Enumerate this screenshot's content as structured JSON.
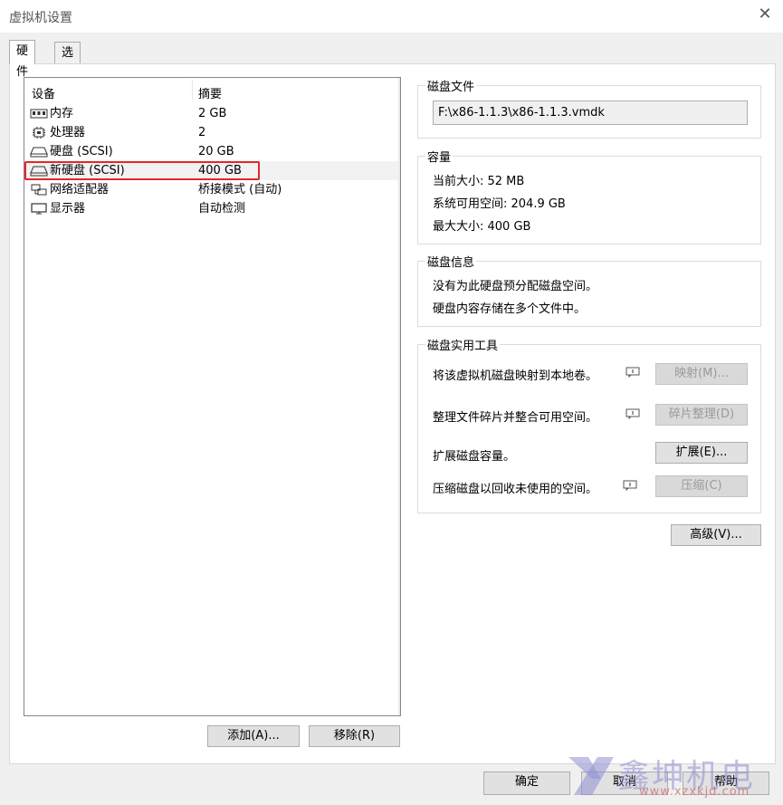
{
  "window": {
    "title": "虚拟机设置",
    "close_glyph": "✕"
  },
  "tabs": [
    {
      "label": "硬件",
      "active": true
    },
    {
      "label": "选项",
      "active": false
    }
  ],
  "devices": {
    "col_device": "设备",
    "col_summary": "摘要",
    "rows": [
      {
        "icon": "memory-icon",
        "name": "内存",
        "summary": "2 GB"
      },
      {
        "icon": "processor-icon",
        "name": "处理器",
        "summary": "2"
      },
      {
        "icon": "disk-icon",
        "name": "硬盘 (SCSI)",
        "summary": "20 GB"
      },
      {
        "icon": "disk-icon",
        "name": "新硬盘 (SCSI)",
        "summary": "400 GB",
        "selected": true
      },
      {
        "icon": "network-adapter-icon",
        "name": "网络适配器",
        "summary": "桥接模式 (自动)"
      },
      {
        "icon": "display-icon",
        "name": "显示器",
        "summary": "自动检测"
      }
    ],
    "add_button": "添加(A)...",
    "remove_button": "移除(R)"
  },
  "disk_file": {
    "label": "磁盘文件",
    "path": "F:\\x86-1.1.3\\x86-1.1.3.vmdk"
  },
  "capacity": {
    "label": "容量",
    "current_size": "当前大小: 52 MB",
    "available_space": "系统可用空间: 204.9 GB",
    "max_size": "最大大小: 400 GB"
  },
  "disk_info": {
    "label": "磁盘信息",
    "line1": "没有为此硬盘预分配磁盘空间。",
    "line2": "硬盘内容存储在多个文件中。"
  },
  "disk_utilities": {
    "label": "磁盘实用工具",
    "map_text": "将该虚拟机磁盘映射到本地卷。",
    "map_button": "映射(M)...",
    "defrag_text": "整理文件碎片并整合可用空间。",
    "defrag_button": "碎片整理(D)",
    "expand_text": "扩展磁盘容量。",
    "expand_button": "扩展(E)...",
    "compact_text": "压缩磁盘以回收未使用的空间。",
    "compact_button": "压缩(C)"
  },
  "advanced_button": "高级(V)...",
  "footer": {
    "ok": "确定",
    "cancel": "取消",
    "help": "帮助"
  },
  "watermark": {
    "text": "鑫坤机电",
    "url": "www.xzxkjd.com"
  },
  "colors": {
    "selection_border": "#e3262c",
    "disabled_text": "#9a9a9a"
  }
}
